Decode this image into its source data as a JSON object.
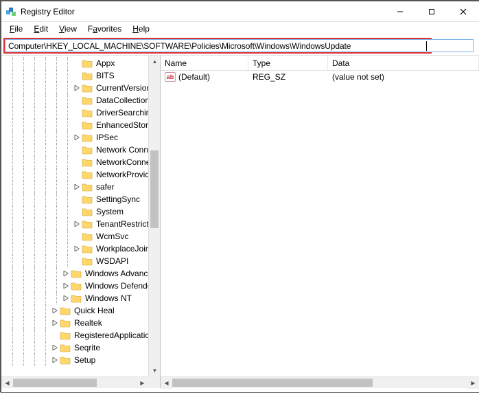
{
  "window": {
    "title": "Registry Editor"
  },
  "menu": {
    "file": {
      "label": "File",
      "accel": "F"
    },
    "edit": {
      "label": "Edit",
      "accel": "E"
    },
    "view": {
      "label": "View",
      "accel": "V"
    },
    "fav": {
      "label": "Favorites",
      "accel": "a"
    },
    "help": {
      "label": "Help",
      "accel": "H"
    }
  },
  "address": {
    "value": "Computer\\HKEY_LOCAL_MACHINE\\SOFTWARE\\Policies\\Microsoft\\Windows\\WindowsUpdate"
  },
  "tree": {
    "items": [
      {
        "depth": 6,
        "expander": "none",
        "label": "Appx"
      },
      {
        "depth": 6,
        "expander": "none",
        "label": "BITS"
      },
      {
        "depth": 6,
        "expander": "closed",
        "label": "CurrentVersion"
      },
      {
        "depth": 6,
        "expander": "none",
        "label": "DataCollection"
      },
      {
        "depth": 6,
        "expander": "none",
        "label": "DriverSearching"
      },
      {
        "depth": 6,
        "expander": "none",
        "label": "EnhancedStorageDevices"
      },
      {
        "depth": 6,
        "expander": "closed",
        "label": "IPSec"
      },
      {
        "depth": 6,
        "expander": "none",
        "label": "Network Connections"
      },
      {
        "depth": 6,
        "expander": "none",
        "label": "NetworkConnectivityStatusIndicator"
      },
      {
        "depth": 6,
        "expander": "none",
        "label": "NetworkProvider"
      },
      {
        "depth": 6,
        "expander": "closed",
        "label": "safer"
      },
      {
        "depth": 6,
        "expander": "none",
        "label": "SettingSync"
      },
      {
        "depth": 6,
        "expander": "none",
        "label": "System"
      },
      {
        "depth": 6,
        "expander": "closed",
        "label": "TenantRestrictions"
      },
      {
        "depth": 6,
        "expander": "none",
        "label": "WcmSvc"
      },
      {
        "depth": 6,
        "expander": "closed",
        "label": "WorkplaceJoin"
      },
      {
        "depth": 6,
        "expander": "none",
        "label": "WSDAPI"
      },
      {
        "depth": 5,
        "expander": "closed",
        "label": "Windows Advanced Threat Protection"
      },
      {
        "depth": 5,
        "expander": "closed",
        "label": "Windows Defender"
      },
      {
        "depth": 5,
        "expander": "closed",
        "label": "Windows NT"
      },
      {
        "depth": 4,
        "expander": "closed",
        "label": "Quick Heal"
      },
      {
        "depth": 4,
        "expander": "closed",
        "label": "Realtek"
      },
      {
        "depth": 4,
        "expander": "none",
        "label": "RegisteredApplications"
      },
      {
        "depth": 4,
        "expander": "closed",
        "label": "Seqrite"
      },
      {
        "depth": 4,
        "expander": "closed",
        "label": "Setup"
      }
    ]
  },
  "list": {
    "columns": {
      "name": "Name",
      "type": "Type",
      "data": "Data"
    },
    "rows": [
      {
        "name": "(Default)",
        "type": "REG_SZ",
        "data": "(value not set)"
      }
    ]
  },
  "tree_scroll": {
    "v_thumb_top_pct": 28,
    "v_thumb_h_pct": 26,
    "h_thumb_left_pct": 0,
    "h_thumb_w_pct": 68
  },
  "list_scroll": {
    "h_thumb_left_pct": 0,
    "h_thumb_w_pct": 68
  }
}
